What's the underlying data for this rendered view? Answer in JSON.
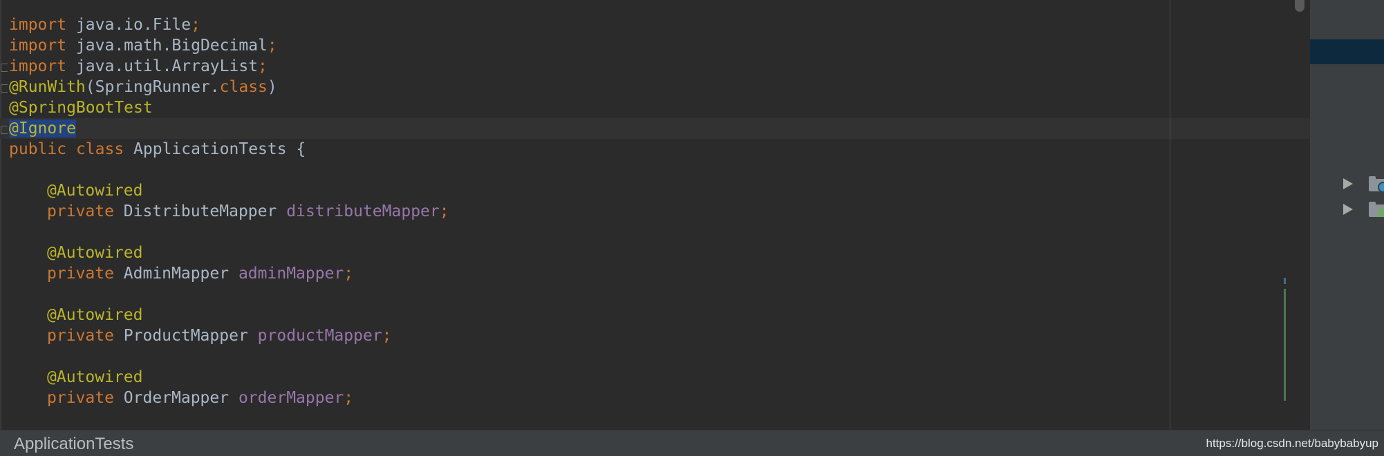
{
  "colors": {
    "editor_bg": "#2b2b2b",
    "keyword": "#cc7832",
    "annotation": "#bbb529",
    "field": "#9876aa",
    "plain": "#a9b7c6",
    "selection": "#214283",
    "panel_bg": "#3c3f41"
  },
  "code": {
    "line1": {
      "kw": "import",
      "text": " java.io.File",
      "punc": ";"
    },
    "line2": {
      "kw": "import",
      "text": " java.math.BigDecimal",
      "punc": ";"
    },
    "line3": {
      "kw": "import",
      "text": " java.util.ArrayList",
      "punc": ";"
    },
    "line4": {
      "ann": "@RunWith",
      "text": "(SpringRunner.",
      "kw": "class",
      "close": ")"
    },
    "line5": {
      "ann": "@SpringBootTest"
    },
    "line6": {
      "ann": "@Ignore"
    },
    "line7": {
      "kw1": "public",
      "kw2": " class",
      "text": " ApplicationTests {"
    },
    "fields": [
      {
        "ann": "@Autowired",
        "kw": "private",
        "type": " DistributeMapper ",
        "name": "distributeMapper",
        "punc": ";"
      },
      {
        "ann": "@Autowired",
        "kw": "private",
        "type": " AdminMapper ",
        "name": "adminMapper",
        "punc": ";"
      },
      {
        "ann": "@Autowired",
        "kw": "private",
        "type": " ProductMapper ",
        "name": "productMapper",
        "punc": ";"
      },
      {
        "ann": "@Autowired",
        "kw": "private",
        "type": " OrderMapper ",
        "name": "orderMapper",
        "punc": ";"
      }
    ]
  },
  "icons": {
    "tree_expand": "triangle-right-icon",
    "folder_gear": "folder-gear-icon",
    "folder_test": "folder-test-icon"
  },
  "status_bar": {
    "breadcrumb": "ApplicationTests",
    "watermark": "https://blog.csdn.net/babybabyup"
  }
}
